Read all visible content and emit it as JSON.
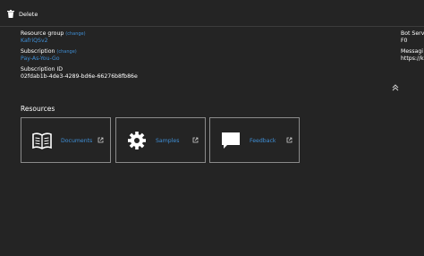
{
  "toolbar": {
    "delete_label": "Delete"
  },
  "essentials": {
    "resource_group": {
      "label": "Resource group",
      "change": "change",
      "value": "KafriQSv2"
    },
    "subscription": {
      "label": "Subscription",
      "change": "change",
      "value": "Pay-As-You-Go"
    },
    "subscription_id": {
      "label": "Subscription ID",
      "value": "02fdab1b-4de3-4289-bd6e-66276b8fb86e"
    },
    "right": {
      "bot_service_label": "Bot Servi",
      "bot_service_value": "F0",
      "messaging_label": "Messagi",
      "messaging_value": "https://k"
    }
  },
  "resources": {
    "title": "Resources",
    "tiles": [
      {
        "label": "Documents",
        "icon": "book-icon"
      },
      {
        "label": "Samples",
        "icon": "gear-icon"
      },
      {
        "label": "Feedback",
        "icon": "speech-bubble-icon"
      }
    ]
  },
  "colors": {
    "background": "#242424",
    "link": "#3f8fd6",
    "border": "#8a8a8a"
  }
}
